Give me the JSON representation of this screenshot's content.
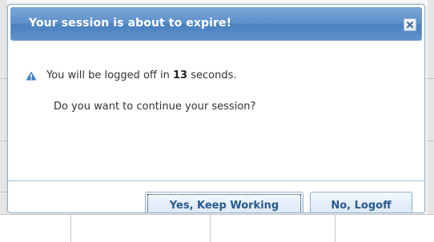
{
  "dialog": {
    "title": "Your session is about to expire!",
    "message_prefix": "You will be logged off in",
    "seconds": "13",
    "message_suffix": "seconds.",
    "question": "Do you want to continue your session?",
    "buttons": {
      "keep_working": "Yes, Keep Working",
      "logoff": "No, Logoff"
    },
    "icons": {
      "warning": "warning-icon",
      "close": "close-icon"
    }
  },
  "colors": {
    "titlebar": "#5c8fc9",
    "button_text": "#2a5a8e",
    "warning": "#3d7fc4"
  }
}
